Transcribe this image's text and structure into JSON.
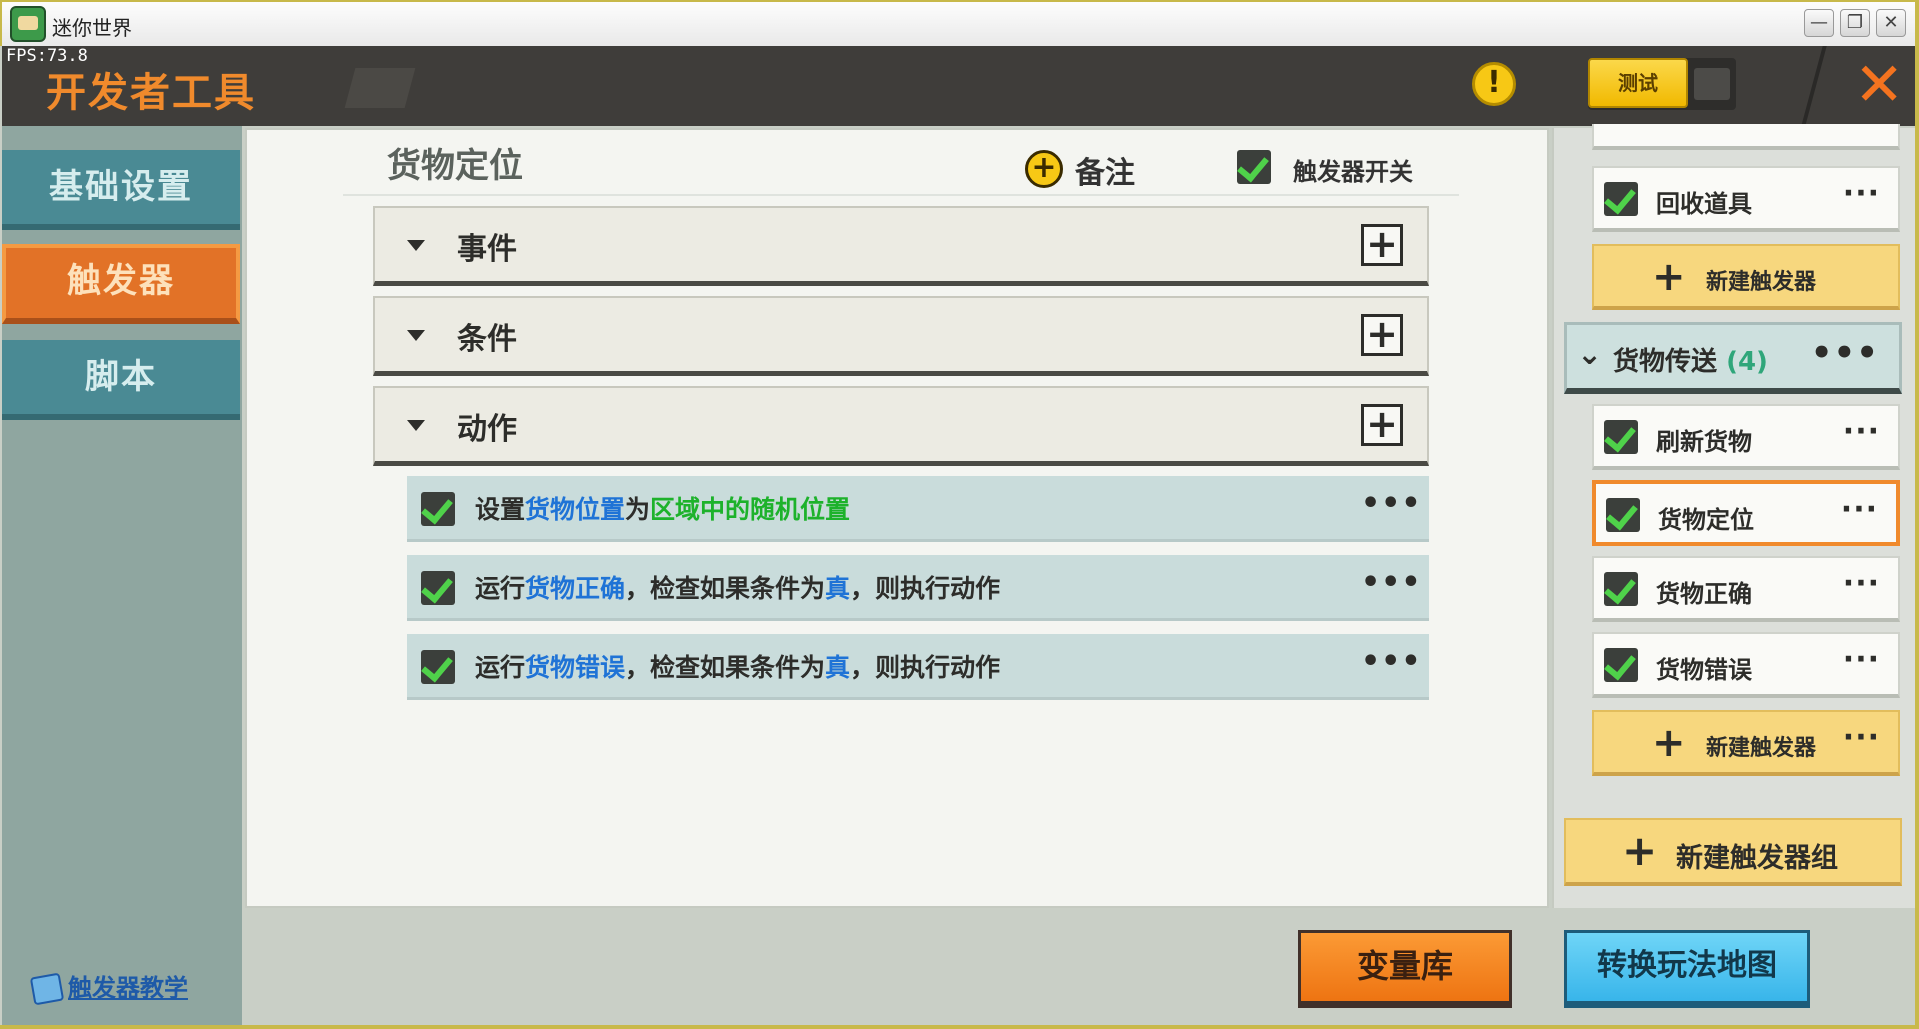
{
  "window": {
    "title": "迷你世界"
  },
  "header": {
    "fps": "FPS:73.8",
    "title": "开发者工具",
    "test_label": "测试"
  },
  "left_nav": {
    "items": [
      {
        "label": "基础设置"
      },
      {
        "label": "触发器"
      },
      {
        "label": "脚本"
      }
    ],
    "active_index": 1,
    "tutorial": "触发器教学"
  },
  "main": {
    "title": "货物定位",
    "note_label": "备注",
    "trigger_switch_label": "触发器开关",
    "sections": [
      {
        "label": "事件"
      },
      {
        "label": "条件"
      },
      {
        "label": "动作"
      }
    ],
    "actions": [
      {
        "p1": "设置",
        "p2": "货物位置",
        "p3": "为",
        "p4": "区域中的随机位置",
        "p5": "",
        "p6": "",
        "more": "•••"
      },
      {
        "p1": "运行",
        "p2": "货物正确",
        "p3": "，检查如果条件为",
        "p4": "真",
        "p5": "，则执行动作",
        "more": "•••"
      },
      {
        "p1": "运行",
        "p2": "货物错误",
        "p3": "，检查如果条件为",
        "p4": "真",
        "p5": "，则执行动作",
        "more": "•••"
      }
    ]
  },
  "right_panel": {
    "top_trigger": {
      "label": "回收道具",
      "more": "···"
    },
    "new_trigger_label": "新建触发器",
    "group": {
      "name": "货物传送",
      "count": "(4)",
      "more": "•••"
    },
    "triggers": [
      {
        "label": "刷新货物",
        "more": "···"
      },
      {
        "label": "货物定位",
        "more": "···"
      },
      {
        "label": "货物正确",
        "more": "···"
      },
      {
        "label": "货物错误",
        "more": "···"
      }
    ],
    "new_trigger_more": "···",
    "new_group_label": "新建触发器组"
  },
  "bottom": {
    "variable_library": "变量库",
    "convert_map": "转换玩法地图"
  },
  "colors": {
    "accent_orange": "#f08a2c",
    "accent_blue": "#1f73d6",
    "accent_green": "#1db22b"
  }
}
